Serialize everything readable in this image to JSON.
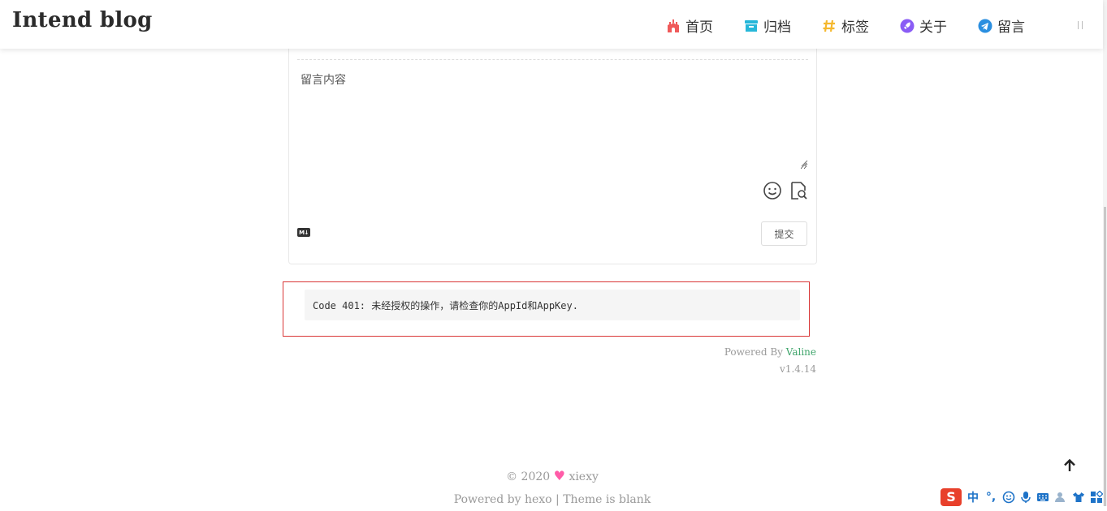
{
  "site": {
    "title": "Intend blog"
  },
  "nav": {
    "items": [
      {
        "label": "首页",
        "icon": "castle-icon",
        "color": "#f05a5a"
      },
      {
        "label": "归档",
        "icon": "archive-box-icon",
        "color": "#26b7d9"
      },
      {
        "label": "标签",
        "icon": "hash-icon",
        "color": "#f5b82e"
      },
      {
        "label": "关于",
        "icon": "rocket-icon",
        "color": "#8a5cf5"
      },
      {
        "label": "留言",
        "icon": "telegram-icon",
        "color": "#2b8fe0"
      }
    ]
  },
  "comment": {
    "placeholder": "留言内容",
    "submit_label": "提交",
    "markdown_badge": "M↓"
  },
  "error": {
    "message": "Code 401: 未经授权的操作，请检查你的AppId和AppKey."
  },
  "valine": {
    "powered_prefix": "Powered By ",
    "powered_link": "Valine",
    "version": "v1.4.14"
  },
  "footer": {
    "copyright_prefix": "© 2020",
    "author": "xiexy",
    "powered_text": "Powered by hexo | Theme is blank"
  },
  "ime": {
    "logo": "S",
    "mode": "中",
    "punct": "°,"
  }
}
